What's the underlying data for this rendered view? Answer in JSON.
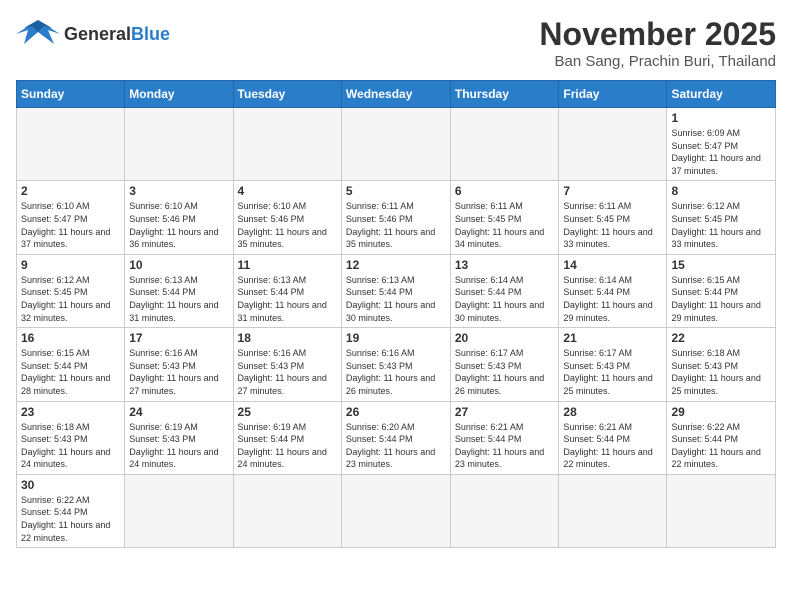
{
  "header": {
    "logo_general": "General",
    "logo_blue": "Blue",
    "month_year": "November 2025",
    "location": "Ban Sang, Prachin Buri, Thailand"
  },
  "days_of_week": [
    "Sunday",
    "Monday",
    "Tuesday",
    "Wednesday",
    "Thursday",
    "Friday",
    "Saturday"
  ],
  "weeks": [
    [
      {
        "day": "",
        "info": ""
      },
      {
        "day": "",
        "info": ""
      },
      {
        "day": "",
        "info": ""
      },
      {
        "day": "",
        "info": ""
      },
      {
        "day": "",
        "info": ""
      },
      {
        "day": "",
        "info": ""
      },
      {
        "day": "1",
        "info": "Sunrise: 6:09 AM\nSunset: 5:47 PM\nDaylight: 11 hours and 37 minutes."
      }
    ],
    [
      {
        "day": "2",
        "info": "Sunrise: 6:10 AM\nSunset: 5:47 PM\nDaylight: 11 hours and 37 minutes."
      },
      {
        "day": "3",
        "info": "Sunrise: 6:10 AM\nSunset: 5:46 PM\nDaylight: 11 hours and 36 minutes."
      },
      {
        "day": "4",
        "info": "Sunrise: 6:10 AM\nSunset: 5:46 PM\nDaylight: 11 hours and 35 minutes."
      },
      {
        "day": "5",
        "info": "Sunrise: 6:11 AM\nSunset: 5:46 PM\nDaylight: 11 hours and 35 minutes."
      },
      {
        "day": "6",
        "info": "Sunrise: 6:11 AM\nSunset: 5:45 PM\nDaylight: 11 hours and 34 minutes."
      },
      {
        "day": "7",
        "info": "Sunrise: 6:11 AM\nSunset: 5:45 PM\nDaylight: 11 hours and 33 minutes."
      },
      {
        "day": "8",
        "info": "Sunrise: 6:12 AM\nSunset: 5:45 PM\nDaylight: 11 hours and 33 minutes."
      }
    ],
    [
      {
        "day": "9",
        "info": "Sunrise: 6:12 AM\nSunset: 5:45 PM\nDaylight: 11 hours and 32 minutes."
      },
      {
        "day": "10",
        "info": "Sunrise: 6:13 AM\nSunset: 5:44 PM\nDaylight: 11 hours and 31 minutes."
      },
      {
        "day": "11",
        "info": "Sunrise: 6:13 AM\nSunset: 5:44 PM\nDaylight: 11 hours and 31 minutes."
      },
      {
        "day": "12",
        "info": "Sunrise: 6:13 AM\nSunset: 5:44 PM\nDaylight: 11 hours and 30 minutes."
      },
      {
        "day": "13",
        "info": "Sunrise: 6:14 AM\nSunset: 5:44 PM\nDaylight: 11 hours and 30 minutes."
      },
      {
        "day": "14",
        "info": "Sunrise: 6:14 AM\nSunset: 5:44 PM\nDaylight: 11 hours and 29 minutes."
      },
      {
        "day": "15",
        "info": "Sunrise: 6:15 AM\nSunset: 5:44 PM\nDaylight: 11 hours and 29 minutes."
      }
    ],
    [
      {
        "day": "16",
        "info": "Sunrise: 6:15 AM\nSunset: 5:44 PM\nDaylight: 11 hours and 28 minutes."
      },
      {
        "day": "17",
        "info": "Sunrise: 6:16 AM\nSunset: 5:43 PM\nDaylight: 11 hours and 27 minutes."
      },
      {
        "day": "18",
        "info": "Sunrise: 6:16 AM\nSunset: 5:43 PM\nDaylight: 11 hours and 27 minutes."
      },
      {
        "day": "19",
        "info": "Sunrise: 6:16 AM\nSunset: 5:43 PM\nDaylight: 11 hours and 26 minutes."
      },
      {
        "day": "20",
        "info": "Sunrise: 6:17 AM\nSunset: 5:43 PM\nDaylight: 11 hours and 26 minutes."
      },
      {
        "day": "21",
        "info": "Sunrise: 6:17 AM\nSunset: 5:43 PM\nDaylight: 11 hours and 25 minutes."
      },
      {
        "day": "22",
        "info": "Sunrise: 6:18 AM\nSunset: 5:43 PM\nDaylight: 11 hours and 25 minutes."
      }
    ],
    [
      {
        "day": "23",
        "info": "Sunrise: 6:18 AM\nSunset: 5:43 PM\nDaylight: 11 hours and 24 minutes."
      },
      {
        "day": "24",
        "info": "Sunrise: 6:19 AM\nSunset: 5:43 PM\nDaylight: 11 hours and 24 minutes."
      },
      {
        "day": "25",
        "info": "Sunrise: 6:19 AM\nSunset: 5:44 PM\nDaylight: 11 hours and 24 minutes."
      },
      {
        "day": "26",
        "info": "Sunrise: 6:20 AM\nSunset: 5:44 PM\nDaylight: 11 hours and 23 minutes."
      },
      {
        "day": "27",
        "info": "Sunrise: 6:21 AM\nSunset: 5:44 PM\nDaylight: 11 hours and 23 minutes."
      },
      {
        "day": "28",
        "info": "Sunrise: 6:21 AM\nSunset: 5:44 PM\nDaylight: 11 hours and 22 minutes."
      },
      {
        "day": "29",
        "info": "Sunrise: 6:22 AM\nSunset: 5:44 PM\nDaylight: 11 hours and 22 minutes."
      }
    ],
    [
      {
        "day": "30",
        "info": "Sunrise: 6:22 AM\nSunset: 5:44 PM\nDaylight: 11 hours and 22 minutes."
      },
      {
        "day": "",
        "info": ""
      },
      {
        "day": "",
        "info": ""
      },
      {
        "day": "",
        "info": ""
      },
      {
        "day": "",
        "info": ""
      },
      {
        "day": "",
        "info": ""
      },
      {
        "day": "",
        "info": ""
      }
    ]
  ]
}
